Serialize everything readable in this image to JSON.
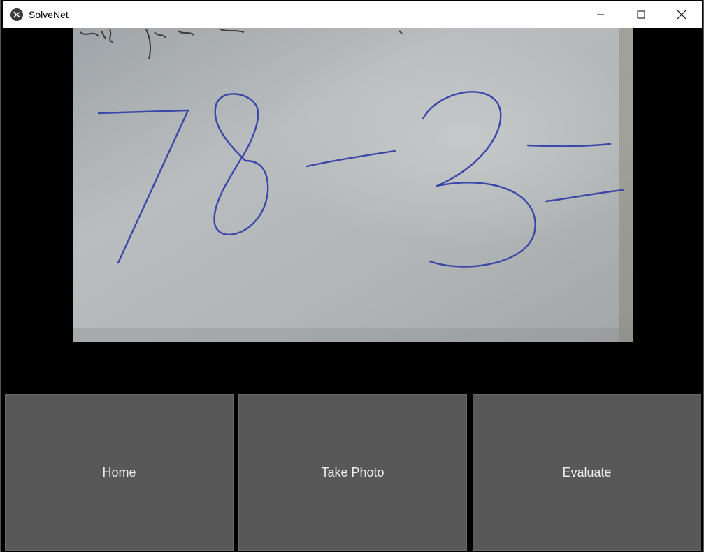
{
  "window": {
    "title": "SolveNet",
    "icon": "kivy-logo-icon",
    "controls": [
      "minimize-icon",
      "maximize-icon",
      "close-icon"
    ]
  },
  "camera": {
    "handwritten_expression": "78-3="
  },
  "buttons": {
    "home": "Home",
    "take_photo": "Take Photo",
    "evaluate": "Evaluate"
  },
  "colors": {
    "background": "#000000",
    "button_bg": "#585858",
    "button_text": "#ececec",
    "ink": "#3b47a8",
    "paper": "#b4b8ba"
  }
}
